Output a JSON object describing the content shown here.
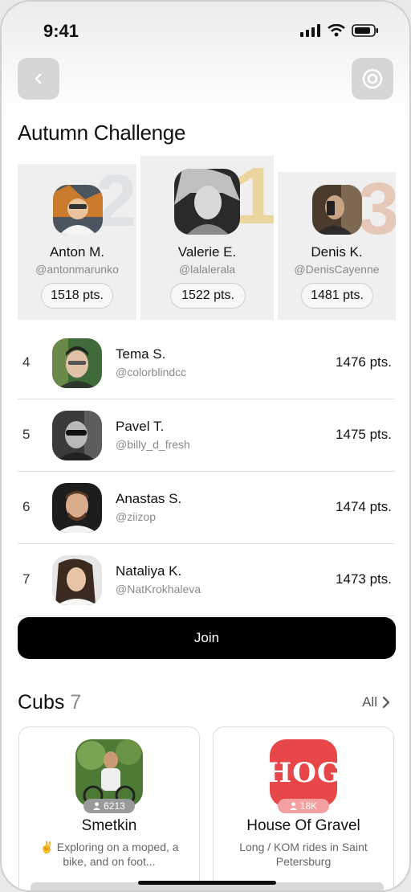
{
  "status": {
    "time": "9:41"
  },
  "title": "Autumn Challenge",
  "podium": [
    {
      "rank": "2",
      "name": "Anton M.",
      "handle": "@antonmarunko",
      "points": "1518 pts.",
      "rank_color": "#dfe3e6"
    },
    {
      "rank": "1",
      "name": "Valerie E.",
      "handle": "@lalalerala",
      "points": "1522 pts.",
      "rank_color": "#ecd6a0"
    },
    {
      "rank": "3",
      "name": "Denis K.",
      "handle": "@DenisCayenne",
      "points": "1481 pts.",
      "rank_color": "#e5c8b8"
    }
  ],
  "leaderboard": [
    {
      "rank": "4",
      "name": "Tema S.",
      "handle": "@colorblindcc",
      "points": "1476 pts."
    },
    {
      "rank": "5",
      "name": "Pavel T.",
      "handle": "@billy_d_fresh",
      "points": "1475 pts."
    },
    {
      "rank": "6",
      "name": "Anastas S.",
      "handle": "@ziizop",
      "points": "1474 pts."
    },
    {
      "rank": "7",
      "name": "Nataliya K.",
      "handle": "@NatKrokhaleva",
      "points": "1473 pts."
    }
  ],
  "join_label": "Join",
  "cubs": {
    "title": "Cubs",
    "count": "7",
    "all_label": "All",
    "items": [
      {
        "name": "Smetkin",
        "members": "6213",
        "description": "✌️ Exploring on a moped, a bike, and on foot..."
      },
      {
        "name": "House Of Gravel",
        "members": "18K",
        "description": "Long / KOM rides in Saint Petersburg",
        "logo_text": "HOG",
        "brand_color": "#e8474a"
      }
    ]
  }
}
